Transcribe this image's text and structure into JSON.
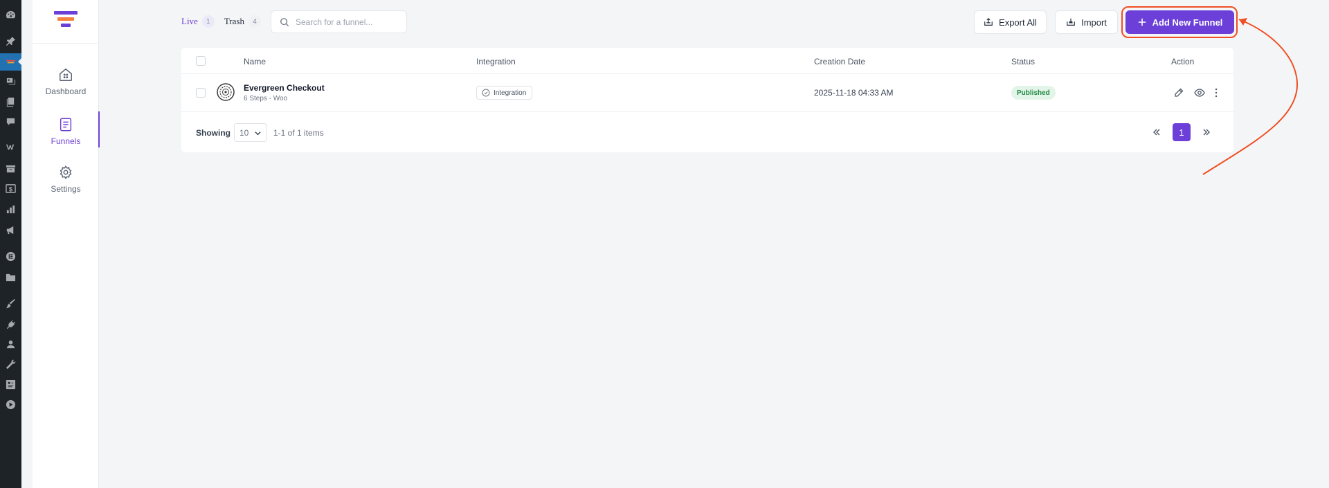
{
  "colors": {
    "accent": "#6b3fd8",
    "highlight": "#f04e23",
    "published_bg": "#e3f4e8",
    "published_text": "#1f8a44"
  },
  "wp_admin_bar": {
    "icons": [
      "dashboard-icon",
      "pin-icon",
      "plugin-active-icon",
      "media-icon",
      "pages-icon",
      "comments-icon",
      "woo-icon",
      "archive-icon",
      "payments-icon",
      "analytics-icon",
      "marketing-icon",
      "elementor-icon",
      "folder-icon",
      "appearance-icon",
      "plugins-icon",
      "users-icon",
      "tools-icon",
      "settings-icon",
      "play-icon"
    ]
  },
  "sidebar": {
    "items": [
      {
        "label": "Dashboard",
        "icon": "home-icon"
      },
      {
        "label": "Funnels",
        "icon": "document-icon",
        "active": true
      },
      {
        "label": "Settings",
        "icon": "gear-icon"
      }
    ]
  },
  "tabs": [
    {
      "label": "Live",
      "count": "1"
    },
    {
      "label": "Trash",
      "count": "4"
    }
  ],
  "search": {
    "placeholder": "Search for a funnel..."
  },
  "toolbar": {
    "export_label": "Export All",
    "import_label": "Import",
    "add_label": "Add New Funnel"
  },
  "table": {
    "columns": [
      "Name",
      "Integration",
      "Creation Date",
      "Status",
      "Action"
    ],
    "rows": [
      {
        "name": "Evergreen Checkout",
        "meta": "6 Steps - Woo",
        "integration": "Integration",
        "creation_date": "2025-11-18 04:33 AM",
        "status": "Published",
        "actions": [
          "edit-icon",
          "eye-icon",
          "more-vertical-icon"
        ]
      }
    ]
  },
  "footer": {
    "showing_label": "Showing",
    "per_page": "10",
    "range": "1-1 of 1 items",
    "current_page": "1"
  }
}
